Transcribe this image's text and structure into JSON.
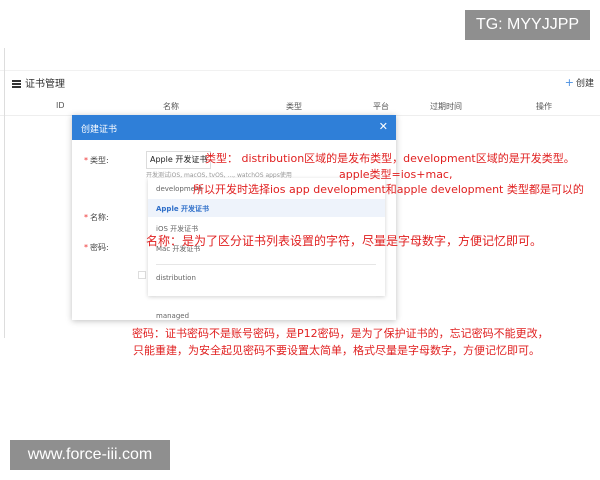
{
  "watermarks": {
    "top": "TG: MYYJJPP",
    "bottom": "www.force-iii.com"
  },
  "header": {
    "title": "证书管理",
    "create_label": "创建"
  },
  "table": {
    "columns": [
      "ID",
      "名称",
      "类型",
      "平台",
      "过期时间",
      "操作"
    ]
  },
  "modal": {
    "title": "创建证书",
    "fields": {
      "type": {
        "label": "类型:",
        "value": "Apple 开发证书",
        "hint": "开发测试iOS, macOS, tvOS, ..., watchOS apps使用"
      },
      "name": {
        "label": "名称:"
      },
      "password": {
        "label": "密码:"
      }
    },
    "dropdown": [
      "development",
      "Apple 开发证书",
      "iOS 开发证书",
      "Mac 开发证书",
      "distribution",
      "managed"
    ],
    "selected_index": 1
  },
  "annotations": {
    "type_line1": "类型： distribution区域的是发布类型，development区域的是开发类型。",
    "type_line2": "apple类型=ios+mac,",
    "type_line3": "所以开发时选择ios app development和apple development 类型都是可以的",
    "name": "名称：是为了区分证书列表设置的字符，尽量是字母数字，方便记忆即可。",
    "password_line1": "密码：证书密码不是账号密码，是P12密码，是为了保护证书的，忘记密码不能更改，",
    "password_line2": "只能重建，为安全起见密码不要设置太简单，格式尽量是字母数字，方便记忆即可。"
  },
  "colors": {
    "accent": "#2f7fd8",
    "annotation": "#e02020",
    "watermark_bg": "#8f8f8f"
  }
}
